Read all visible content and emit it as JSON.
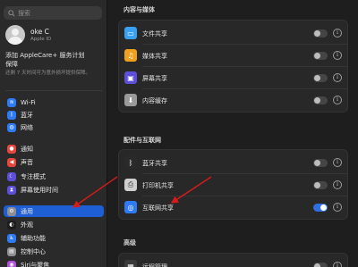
{
  "sidebar": {
    "search_placeholder": "搜索",
    "profile": {
      "name": "oke C",
      "subtitle": "Apple ID"
    },
    "applecare": {
      "title_line1": "添加 AppleCare+ 服务计划",
      "title_line2": "保障",
      "desc": "还剩 7 天时间可为意外损坏提供保障。"
    },
    "items": [
      {
        "label": "Wi-Fi",
        "icon": "wifi-icon",
        "color": "#2f7bf5",
        "glyph": "≋"
      },
      {
        "label": "蓝牙",
        "icon": "bluetooth-icon",
        "color": "#2f7bf5",
        "glyph": "ᛒ"
      },
      {
        "label": "网络",
        "icon": "network-icon",
        "color": "#2f7bf5",
        "glyph": "◍"
      },
      {
        "label": "通知",
        "icon": "bell-icon",
        "color": "#e5463e",
        "glyph": "●"
      },
      {
        "label": "声音",
        "icon": "speaker-icon",
        "color": "#e5463e",
        "glyph": "◀"
      },
      {
        "label": "专注模式",
        "icon": "moon-icon",
        "color": "#5e4fd8",
        "glyph": "☾"
      },
      {
        "label": "屏幕使用时间",
        "icon": "hourglass-icon",
        "color": "#5e4fd8",
        "glyph": "⧗"
      },
      {
        "label": "通用",
        "icon": "gear-icon",
        "color": "#8e8e93",
        "glyph": "⚙"
      },
      {
        "label": "外观",
        "icon": "appearance-icon",
        "color": "#1c1c1c",
        "glyph": "◐"
      },
      {
        "label": "辅助功能",
        "icon": "accessibility-icon",
        "color": "#2f7bf5",
        "glyph": "♿"
      },
      {
        "label": "控制中心",
        "icon": "control-center-icon",
        "color": "#8e8e93",
        "glyph": "▤"
      },
      {
        "label": "Siri与聚焦",
        "icon": "siri-icon",
        "color": "#b04fd8",
        "glyph": "◉"
      }
    ],
    "active_index": 7
  },
  "main": {
    "sections": [
      {
        "title": "内容与媒体",
        "rows": [
          {
            "label": "文件共享",
            "icon": "folder-icon",
            "color": "#3aa0f0",
            "glyph": "▭",
            "toggle": false
          },
          {
            "label": "媒体共享",
            "icon": "music-icon",
            "color": "#f0a020",
            "glyph": "♫",
            "toggle": false
          },
          {
            "label": "屏幕共享",
            "icon": "screen-sharing-icon",
            "color": "#5e4fd8",
            "glyph": "▣",
            "toggle": false
          },
          {
            "label": "内容缓存",
            "icon": "content-cache-icon",
            "color": "#9a9a9a",
            "glyph": "⬇",
            "toggle": false
          }
        ]
      },
      {
        "title": "配件与互联网",
        "rows": [
          {
            "label": "蓝牙共享",
            "icon": "bluetooth-icon",
            "color": "#2a2a2a",
            "glyph": "ᛒ",
            "toggle": false
          },
          {
            "label": "打印机共享",
            "icon": "printer-icon",
            "color": "#cfcfcf",
            "glyph": "⎙",
            "toggle": false
          },
          {
            "label": "互联网共享",
            "icon": "globe-icon",
            "color": "#2f7bf5",
            "glyph": "◎",
            "toggle": true
          }
        ]
      },
      {
        "title": "高级",
        "rows": [
          {
            "label": "远程管理",
            "icon": "remote-management-icon",
            "color": "#3a3a3a",
            "glyph": "▦",
            "toggle": false
          }
        ]
      }
    ]
  },
  "colors": {
    "accent": "#1f5fd6",
    "annotation_arrow": "#d81b1b"
  }
}
